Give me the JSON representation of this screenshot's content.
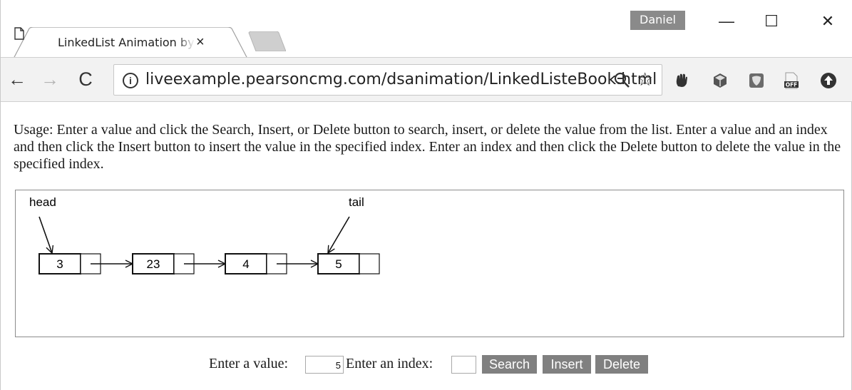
{
  "browser": {
    "tab_title": "LinkedList Animation by Y. Daniel Liang",
    "tab_close": "×",
    "user_badge": "Daniel",
    "window_minimize": "—",
    "window_maximize": "☐",
    "window_close": "✕",
    "back": "←",
    "forward": "→",
    "reload": "C",
    "info": "i",
    "url": "liveexample.pearsoncmg.com/dsanimation/LinkedListeBook.html",
    "bookmark": "☆"
  },
  "page": {
    "usage": "Usage: Enter a value and click the Search, Insert, or Delete button to search, insert, or delete the value from the list. Enter a value and an index and then click the Insert button to insert the value in the specified index. Enter an index and then click the Delete button to delete the value in the specified index."
  },
  "list": {
    "nodes": [
      "3",
      "23",
      "4",
      "5"
    ],
    "head_label": "head",
    "tail_label": "tail"
  },
  "controls": {
    "value_label": "Enter a value:",
    "value_input": "5",
    "index_label": "Enter an index:",
    "index_input": "",
    "search_label": "Search",
    "insert_label": "Insert",
    "delete_label": "Delete"
  },
  "icons": {
    "page": "page-icon",
    "zoom": "zoom-out-icon",
    "star": "star-icon",
    "extensions": [
      "hand-extension-icon",
      "cube-extension-icon",
      "shield-extension-icon",
      "off-extension-icon",
      "upload-extension-icon"
    ]
  }
}
